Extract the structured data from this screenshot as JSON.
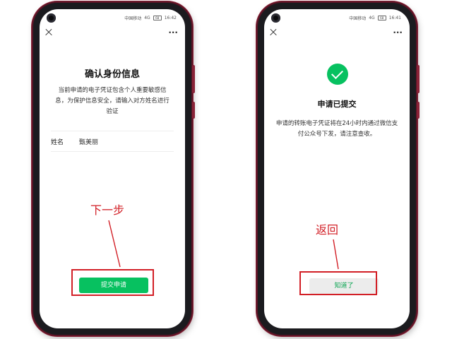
{
  "left_phone": {
    "status": {
      "carrier": "中国移动",
      "net": "4G",
      "time": "16:42",
      "battery": "68"
    },
    "title": "确认身份信息",
    "description": "当前申请的电子凭证包含个人重要敏感信息，为保护信息安全，请输入对方姓名进行验证",
    "name_label": "姓名",
    "name_value": "甄美丽",
    "submit_button": "提交申请",
    "annotation": "下一步"
  },
  "right_phone": {
    "status": {
      "carrier": "中国移动",
      "net": "4G",
      "time": "16:41",
      "battery": "68"
    },
    "title": "申请已提交",
    "description": "申请的转账电子凭证将在24小时内通过微信支付公众号下发，请注意查收。",
    "ok_button": "知道了",
    "annotation": "返回"
  },
  "colors": {
    "accent_green": "#07c160",
    "annotation_red": "#d21f26",
    "phone_frame": "#8a2338"
  },
  "icons": [
    "close-icon",
    "more-icon",
    "check-circle-icon",
    "camera-icon"
  ]
}
